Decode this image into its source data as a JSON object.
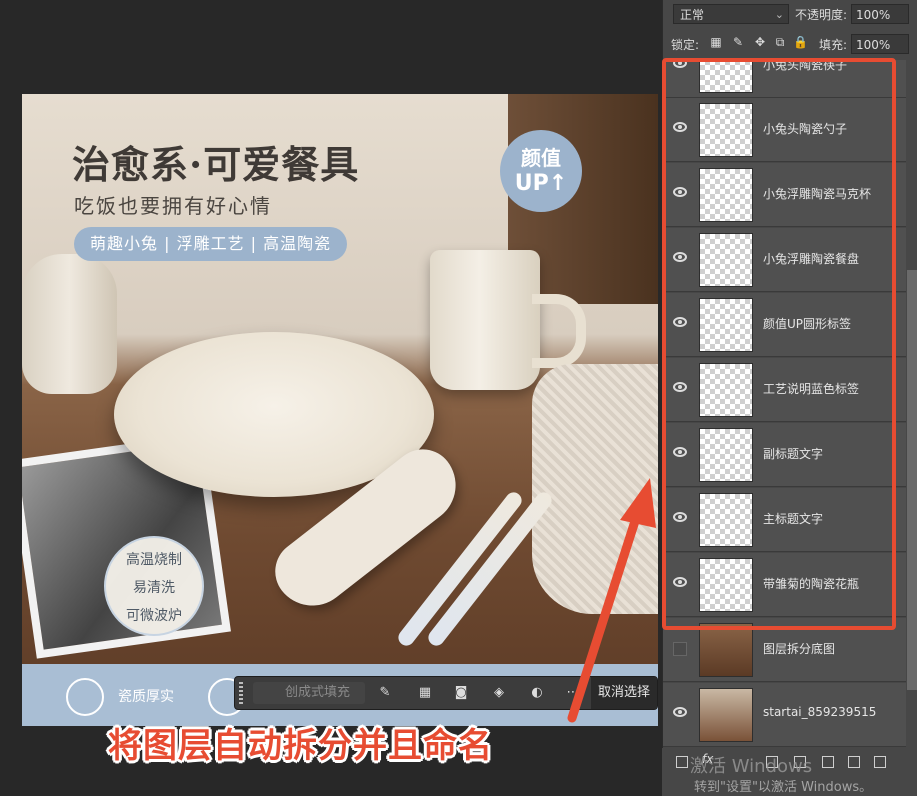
{
  "document_canvas": {
    "title": "治愈系·可爱餐具",
    "subtitle": "吃饭也要拥有好心情",
    "tagbar": "萌趣小兔 | 浮雕工艺 | 高温陶瓷",
    "badge_line1": "颜值",
    "badge_line2": "UP↑",
    "features": [
      "高温烧制",
      "易清洗",
      "可微波炉"
    ],
    "bottom_label": "瓷质厚实"
  },
  "context_bar": {
    "generate_placeholder": "创成式填充",
    "cancel_selection": "取消选择"
  },
  "caption": "将图层自动拆分并且命名",
  "layers_panel": {
    "blend_mode": "正常",
    "opacity_label": "不透明度:",
    "opacity_value": "100%",
    "lock_label": "锁定:",
    "fill_label": "填充:",
    "fill_value": "100%",
    "layers": [
      {
        "name": "小兔头陶瓷筷子",
        "visible": true
      },
      {
        "name": "小兔头陶瓷勺子",
        "visible": true
      },
      {
        "name": "小兔浮雕陶瓷马克杯",
        "visible": true
      },
      {
        "name": "小兔浮雕陶瓷餐盘",
        "visible": true
      },
      {
        "name": "颜值UP圆形标签",
        "visible": true
      },
      {
        "name": "工艺说明蓝色标签",
        "visible": true
      },
      {
        "name": "副标题文字",
        "visible": true
      },
      {
        "name": "主标题文字",
        "visible": true
      },
      {
        "name": "带雏菊的陶瓷花瓶",
        "visible": true
      },
      {
        "name": "图层拆分底图",
        "visible": false
      },
      {
        "name": "startai_859239515",
        "visible": true
      }
    ],
    "footer_fx": "fx"
  },
  "watermark": {
    "line1": "激活 Windows",
    "line2": "转到\"设置\"以激活 Windows。"
  },
  "colors": {
    "accent_red": "#e74c32",
    "label_blue": "#9cb3cc",
    "panel_bg": "#474747"
  }
}
